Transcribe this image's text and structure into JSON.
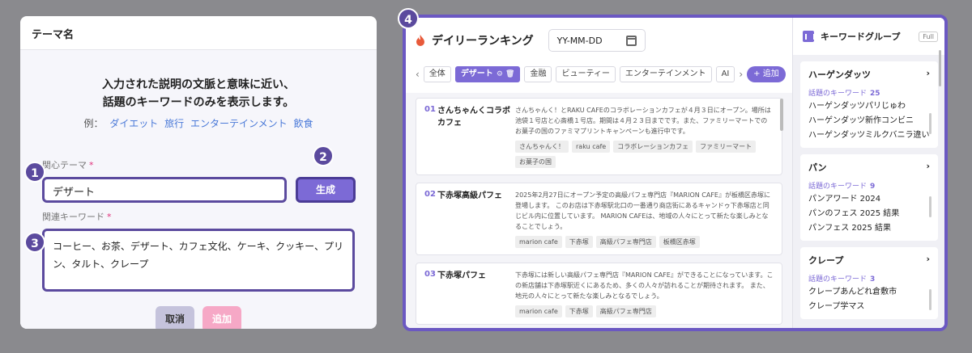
{
  "modal": {
    "title": "テーマ名",
    "desc_line1": "入力された説明の文脈と意味に近い、",
    "desc_line2": "話題のキーワードのみを表示します。",
    "examples_label": "例：",
    "examples": [
      "ダイエット",
      "旅行",
      "エンターテインメント",
      "飲食"
    ],
    "interest_label": "関心テーマ",
    "interest_value": "デザート",
    "generate_label": "生成",
    "related_label": "関連キーワード",
    "related_value": "コーヒー、お茶、デザート、カフェ文化、ケーキ、クッキー、プリン、タルト、クレープ",
    "cancel_label": "取消",
    "add_label": "追加",
    "required_mark": "*"
  },
  "badges": [
    "1",
    "2",
    "3",
    "4"
  ],
  "ranking": {
    "title": "デイリーランキング",
    "date_placeholder": "YY-MM-DD",
    "tabs": [
      "全体",
      "デザート",
      "金融",
      "ビューティー",
      "エンターテインメント",
      "AI"
    ],
    "active_tab_icons": "⚙ 🗑",
    "add_tab_label": "+ 追加",
    "items": [
      {
        "rank": "01",
        "title": "さんちゃんくコラボカフェ",
        "text": "さんちゃんく！とRAKU CAFEのコラボレーションカフェが４月３日にオープン。場所は池袋１号店と心斎橋１号店。期間は４月２３日までです。また、ファミリーマートでのお菓子の国のファミマプリントキャンペーンも進行中です。",
        "tags": [
          "さんちゃんく！",
          "raku cafe",
          "コラボレーションカフェ",
          "ファミリーマート",
          "お菓子の国"
        ]
      },
      {
        "rank": "02",
        "title": "下赤塚高級パフェ",
        "text": "2025年2月27日にオープン予定の高級パフェ専門店『MARION CAFE』が板橋区赤塚に登場します。 このお店は下赤塚駅北口の一番通り商店街にあるキャンドゥ下赤塚店と同じビル内に位置しています。 MARION CAFEは、地域の人々にとって新たな楽しみとなることでしょう。",
        "tags": [
          "marion cafe",
          "下赤塚",
          "高級パフェ専門店",
          "板橋区赤塚"
        ]
      },
      {
        "rank": "03",
        "title": "下赤塚パフェ",
        "text": "下赤塚には新しい高級パフェ専門店『MARION CAFE』ができることになっています。この新店舗は下赤塚駅近くにあるため、多くの人々が訪れることが期待されます。 また、地元の人々にとって新たな楽しみとなるでしょう。",
        "tags": [
          "marion cafe",
          "下赤塚",
          "高級パフェ専門店"
        ]
      }
    ]
  },
  "keyword_groups": {
    "title": "キーワードグループ",
    "full_label": "Full",
    "sub_label": "話題のキーワード",
    "groups": [
      {
        "name": "ハーゲンダッツ",
        "count": "25",
        "keywords": [
          "ハーゲンダッツパリじゅわ",
          "ハーゲンダッツ新作コンビニ",
          "ハーゲンダッツミルクバニラ違い"
        ]
      },
      {
        "name": "パン",
        "count": "9",
        "keywords": [
          "パンアワード 2024",
          "パンのフェス 2025 結果",
          "パンフェス 2025 結果"
        ]
      },
      {
        "name": "クレープ",
        "count": "3",
        "keywords": [
          "クレープあんどれ倉敷市",
          "クレープ学マス"
        ]
      }
    ]
  },
  "colors": {
    "accent": "#7c6ad6",
    "badge": "#5b4a9e",
    "required": "#e0307a",
    "link": "#4a79d8"
  }
}
